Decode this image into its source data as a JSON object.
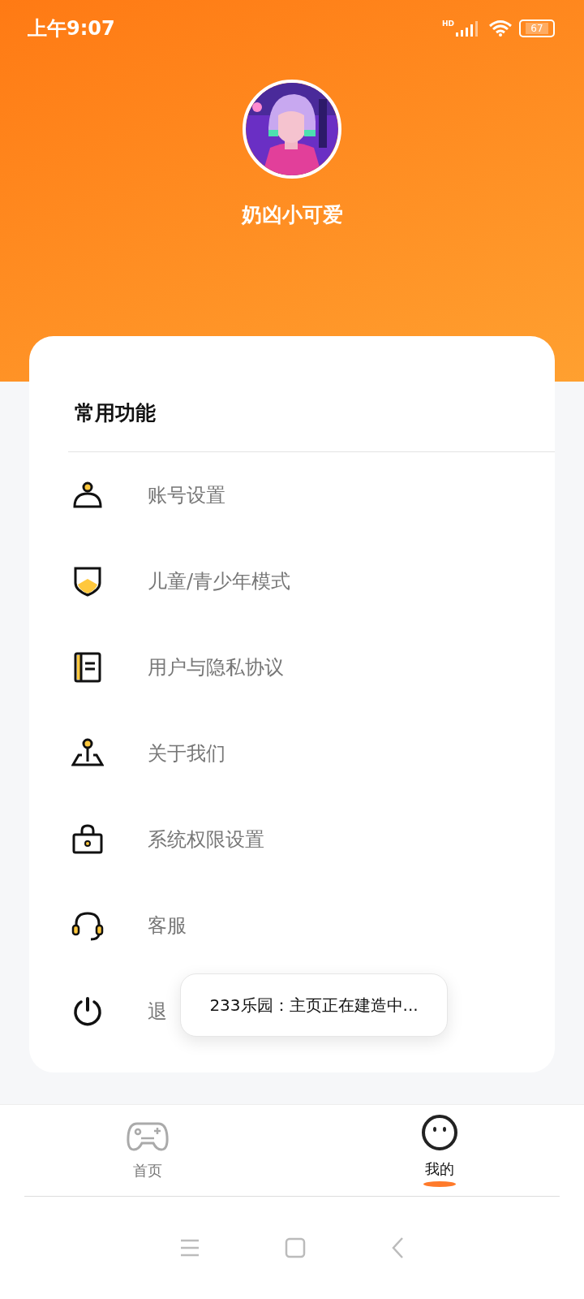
{
  "status_bar": {
    "time": "上午9:07",
    "network": "HD",
    "battery": "67"
  },
  "profile": {
    "username": "奶凶小可爱"
  },
  "section": {
    "title": "常用功能",
    "items": [
      {
        "kind": "account",
        "label": "账号设置"
      },
      {
        "kind": "shield",
        "label": "儿童/青少年模式"
      },
      {
        "kind": "book",
        "label": "用户与隐私协议"
      },
      {
        "kind": "joystick",
        "label": "关于我们"
      },
      {
        "kind": "lock",
        "label": "系统权限设置"
      },
      {
        "kind": "headset",
        "label": "客服"
      },
      {
        "kind": "power",
        "label": "退"
      }
    ]
  },
  "toast": {
    "text": "233乐园：主页正在建造中..."
  },
  "tabs": [
    {
      "kind": "gamepad",
      "label": "首页",
      "selected": false
    },
    {
      "kind": "face",
      "label": "我的",
      "selected": true
    }
  ]
}
